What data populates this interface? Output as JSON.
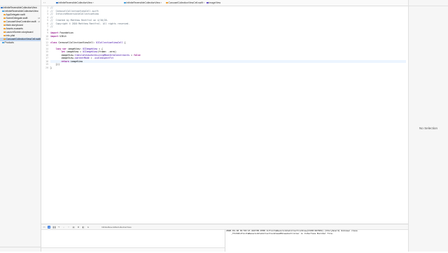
{
  "navigator": {
    "items": [
      {
        "label": "InfiniteReversibleCollectionView",
        "icon": "project-icon",
        "indent": 0,
        "selected": false,
        "badge": ""
      },
      {
        "label": "InfiniteReversibleCollectionView",
        "icon": "folder-icon",
        "indent": 1,
        "selected": false,
        "badge": ""
      },
      {
        "label": "AppDelegate.swift",
        "icon": "swift-file-icon",
        "indent": 2,
        "selected": false,
        "badge": ""
      },
      {
        "label": "SceneDelegate.swift",
        "icon": "swift-file-icon",
        "indent": 2,
        "selected": false,
        "badge": "M"
      },
      {
        "label": "CarouselViewController.swift",
        "icon": "swift-file-icon",
        "indent": 2,
        "selected": false,
        "badge": "M"
      },
      {
        "label": "Main.storyboard",
        "icon": "storyboard-icon",
        "indent": 2,
        "selected": false,
        "badge": ""
      },
      {
        "label": "Assets.xcassets",
        "icon": "assets-icon",
        "indent": 2,
        "selected": false,
        "badge": ""
      },
      {
        "label": "LaunchScreen.storyboard",
        "icon": "storyboard-icon",
        "indent": 2,
        "selected": false,
        "badge": ""
      },
      {
        "label": "Info.plist",
        "icon": "plist-icon",
        "indent": 2,
        "selected": false,
        "badge": ""
      },
      {
        "label": "CarouselCollectionViewCell.swift",
        "icon": "swift-file-icon",
        "indent": 2,
        "selected": true,
        "badge": "A"
      },
      {
        "label": "Products",
        "icon": "folder-icon",
        "indent": 1,
        "selected": false,
        "badge": ""
      }
    ]
  },
  "jumpbar": {
    "crumbs": [
      {
        "label": "InfiniteReversibleCollectionView",
        "icon": "project-icon"
      },
      {
        "label": "InfiniteReversibleCollectionView",
        "icon": "folder-icon"
      },
      {
        "label": "CarouselCollectionViewCell.swift",
        "icon": "swift-file-icon"
      },
      {
        "label": "imageView",
        "icon": "property-icon"
      }
    ]
  },
  "editor": {
    "current_line": 18,
    "lines": [
      [
        {
          "t": "//",
          "c": "comment"
        }
      ],
      [
        {
          "t": "//  CarouselCollectionViewCell.swift",
          "c": "comment"
        }
      ],
      [
        {
          "t": "//  InfiniteReversibleCollectionView",
          "c": "comment"
        }
      ],
      [
        {
          "t": "//",
          "c": "comment"
        }
      ],
      [
        {
          "t": "//  Created by Matthew Rentfrol on 4/18/20.",
          "c": "comment"
        }
      ],
      [
        {
          "t": "//  Copyright © 2020 Matthew Rentfrol. All rights reserved.",
          "c": "comment"
        }
      ],
      [
        {
          "t": "//",
          "c": "comment"
        }
      ],
      [],
      [
        {
          "t": "import",
          "c": "kw"
        },
        {
          "t": " Foundation",
          "c": ""
        }
      ],
      [
        {
          "t": "import",
          "c": "kw"
        },
        {
          "t": " UIKit",
          "c": ""
        }
      ],
      [],
      [
        {
          "t": "class",
          "c": "kw"
        },
        {
          "t": " CarouselCollectionViewCell: ",
          "c": ""
        },
        {
          "t": "UICollectionViewCell",
          "c": "type"
        },
        {
          "t": " {",
          "c": ""
        }
      ],
      [],
      [
        {
          "t": "    ",
          "c": ""
        },
        {
          "t": "lazy var",
          "c": "kw"
        },
        {
          "t": " imageView: ",
          "c": ""
        },
        {
          "t": "UIImageView",
          "c": "type"
        },
        {
          "t": " = {",
          "c": ""
        }
      ],
      [
        {
          "t": "        ",
          "c": ""
        },
        {
          "t": "let",
          "c": "kw"
        },
        {
          "t": " imageView = ",
          "c": ""
        },
        {
          "t": "UIImageView",
          "c": "type"
        },
        {
          "t": "(frame: .zero)",
          "c": ""
        }
      ],
      [
        {
          "t": "        imageView.",
          "c": ""
        },
        {
          "t": "translatesAutoresizingMaskIntoConstraints",
          "c": "type"
        },
        {
          "t": " = ",
          "c": ""
        },
        {
          "t": "false",
          "c": "kw"
        }
      ],
      [
        {
          "t": "        imageView.",
          "c": ""
        },
        {
          "t": "contentMode",
          "c": "type"
        },
        {
          "t": " = .",
          "c": ""
        },
        {
          "t": "scaleAspectFit",
          "c": "type"
        }
      ],
      [
        {
          "t": "        ",
          "c": ""
        },
        {
          "t": "return",
          "c": "kw"
        },
        {
          "t": " imageView",
          "c": ""
        }
      ],
      [
        {
          "t": "    }()",
          "c": ""
        }
      ],
      [
        {
          "t": "}",
          "c": ""
        }
      ]
    ]
  },
  "debug": {
    "target_label": "InfiniteReversibleCollectionView",
    "console_text": "2020-04-18 01:59:13.441738-0700 InfiniteReversibleCollectionView[3190:267654] [Storyboard] Unknown class\n    _TtC32InfiniteReversibleCollectionView26ViewController in Interface Builder file."
  },
  "inspector": {
    "empty_label": "No Selection"
  },
  "colors": {
    "selection": "#c4d8f2",
    "current_line": "#ecf5ff",
    "comment": "#5d6c79",
    "keyword": "#9b2393",
    "type": "#3900a0"
  }
}
